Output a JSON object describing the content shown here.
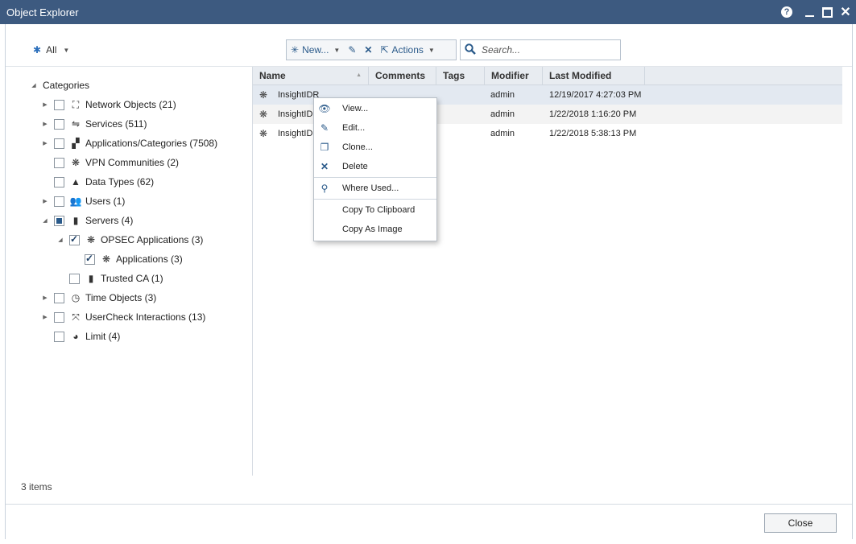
{
  "window": {
    "title": "Object Explorer"
  },
  "filter": {
    "label": "All"
  },
  "toolbar": {
    "new_label": "New...",
    "actions_label": "Actions"
  },
  "search": {
    "placeholder": "Search..."
  },
  "tree": {
    "root_label": "Categories",
    "items": [
      {
        "label": "Network Objects (21)",
        "icon": "network-icon"
      },
      {
        "label": "Services (511)",
        "icon": "services-icon"
      },
      {
        "label": "Applications/Categories (7508)",
        "icon": "apps-icon"
      },
      {
        "label": "VPN Communities (2)",
        "icon": "vpn-icon"
      },
      {
        "label": "Data Types (62)",
        "icon": "data-types-icon"
      },
      {
        "label": "Users (1)",
        "icon": "users-icon"
      },
      {
        "label": "Servers (4)",
        "icon": "server-icon"
      },
      {
        "label": "OPSEC Applications (3)",
        "icon": "opsec-icon"
      },
      {
        "label": "Applications (3)",
        "icon": "opsec-icon"
      },
      {
        "label": "Trusted CA (1)",
        "icon": "server-icon"
      },
      {
        "label": "Time Objects (3)",
        "icon": "clock-icon"
      },
      {
        "label": "UserCheck Interactions (13)",
        "icon": "usercheck-icon"
      },
      {
        "label": "Limit (4)",
        "icon": "limit-icon"
      }
    ]
  },
  "grid": {
    "columns": [
      "Name",
      "Comments",
      "Tags",
      "Modifier",
      "Last Modified"
    ],
    "rows": [
      {
        "name": "InsightIDR",
        "modifier": "admin",
        "modified": "12/19/2017 4:27:03 PM"
      },
      {
        "name": "InsightID",
        "modifier": "admin",
        "modified": "1/22/2018 1:16:20 PM"
      },
      {
        "name": "InsightID",
        "modifier": "admin",
        "modified": "1/22/2018 5:38:13 PM"
      }
    ]
  },
  "context_menu": {
    "view": "View...",
    "edit": "Edit...",
    "clone": "Clone...",
    "delete": "Delete",
    "where_used": "Where Used...",
    "copy_clipboard": "Copy To Clipboard",
    "copy_image": "Copy As Image"
  },
  "status": {
    "count": "3 items"
  },
  "footer": {
    "close_label": "Close"
  }
}
